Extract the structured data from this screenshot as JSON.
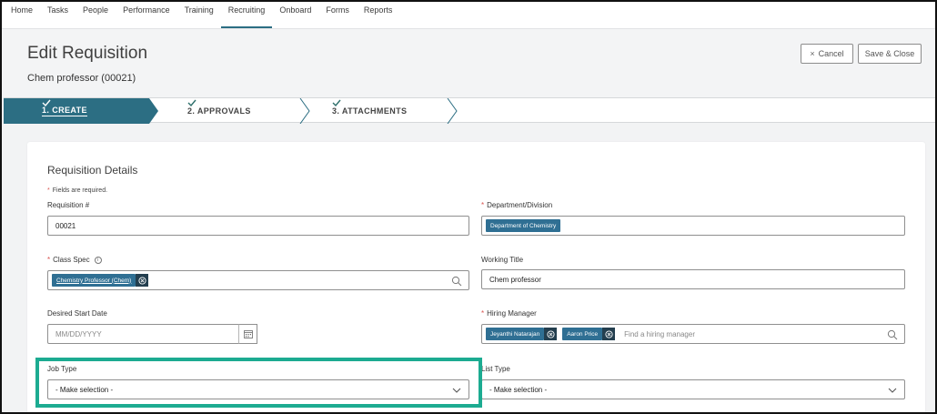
{
  "nav": {
    "items": [
      "Home",
      "Tasks",
      "People",
      "Performance",
      "Training",
      "Recruiting",
      "Onboard",
      "Forms",
      "Reports"
    ],
    "active": "Recruiting"
  },
  "header": {
    "title": "Edit Requisition",
    "subtitle": "Chem professor (00021)",
    "cancel_label": "Cancel",
    "save_label": "Save & Close"
  },
  "steps": [
    {
      "label": "1. CREATE",
      "state": "active-complete"
    },
    {
      "label": "2. APPROVALS",
      "state": "complete"
    },
    {
      "label": "3. ATTACHMENTS",
      "state": "complete"
    }
  ],
  "form": {
    "section_title": "Requisition Details",
    "required_note": "Fields are required.",
    "requisition": {
      "label": "Requisition #",
      "value": "00021"
    },
    "department": {
      "label": "Department/Division",
      "chip": "Department of Chemistry",
      "required": true
    },
    "class_spec": {
      "label": "Class Spec",
      "chip": "Chemistry Professor (Chem)",
      "required": true
    },
    "working_title": {
      "label": "Working Title",
      "value": "Chem professor"
    },
    "start_date": {
      "label": "Desired Start Date",
      "placeholder": "MM/DD/YYYY"
    },
    "hiring_manager": {
      "label": "Hiring Manager",
      "required": true,
      "chips": [
        "Jeyanthi Natarajan",
        "Aaron Price"
      ],
      "placeholder": "Find a hiring manager"
    },
    "job_type": {
      "label": "Job Type",
      "value": "- Make selection -"
    },
    "list_type": {
      "label": "List Type",
      "value": "- Make selection -"
    }
  },
  "colors": {
    "accent": "#2c6e83",
    "chip": "#2f6f93",
    "highlight": "#1cab91",
    "required": "#d9534f"
  }
}
